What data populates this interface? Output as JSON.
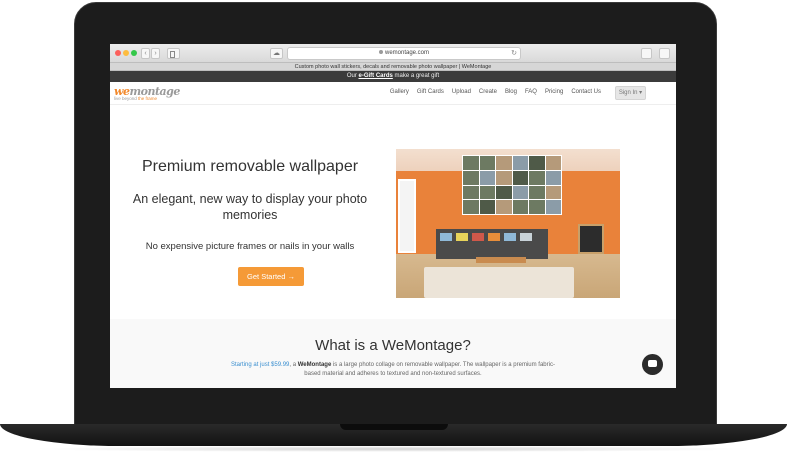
{
  "browser": {
    "url": "wemontage.com",
    "tab_title": "Custom photo wall stickers, decals and removable photo wallpaper | WeMontage"
  },
  "promo": {
    "prefix": "Our ",
    "link": "e-Gift Cards",
    "suffix": " make a great gift"
  },
  "logo": {
    "we": "we",
    "montage": "montage",
    "tagline_prefix": "live beyond ",
    "tagline_frame": "the frame"
  },
  "nav": {
    "items": [
      "Gallery",
      "Gift Cards",
      "Upload",
      "Create",
      "Blog",
      "FAQ",
      "Pricing",
      "Contact Us"
    ],
    "signin": "Sign In"
  },
  "hero": {
    "title": "Premium removable wallpaper",
    "subtitle": "An elegant, new way to display your photo memories",
    "note": "No expensive picture frames or nails in your walls",
    "cta": "Get Started →"
  },
  "whatis": {
    "title": "What is a WeMontage?",
    "link": "Starting at just $59.99",
    "text_1": ", a ",
    "brand": "WeMontage",
    "text_2": " is a large photo collage on removable wallpaper. The wallpaper is a premium fabric-based material and adheres to textured and non-textured surfaces."
  },
  "colors": {
    "accent": "#f59a37",
    "promo_bg": "#3b3b3b",
    "link": "#3a8fd0"
  }
}
